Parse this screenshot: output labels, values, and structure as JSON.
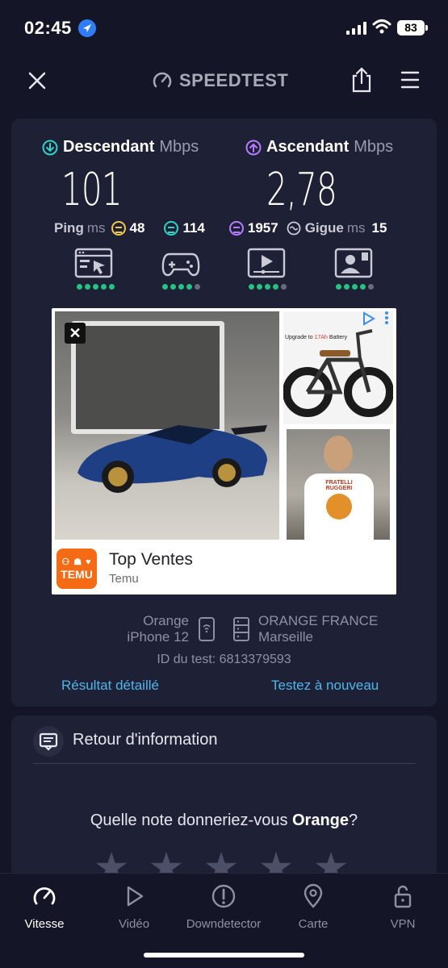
{
  "status": {
    "time": "02:45",
    "battery": "83"
  },
  "header": {
    "brand": "SPEEDTEST"
  },
  "results": {
    "download": {
      "label": "Descendant",
      "unit": "Mbps",
      "value": "101"
    },
    "upload": {
      "label": "Ascendant",
      "unit": "Mbps",
      "value": "2,78"
    },
    "ping": {
      "label": "Ping",
      "unit": "ms",
      "idle": "48",
      "download": "114",
      "upload": "1957"
    },
    "jitter": {
      "label": "Gigue",
      "unit": "ms",
      "value": "15"
    },
    "use_cases": [
      {
        "icon": "web-browsing-icon",
        "rating": 5
      },
      {
        "icon": "gaming-icon",
        "rating": 4
      },
      {
        "icon": "video-streaming-icon",
        "rating": 4
      },
      {
        "icon": "video-call-icon",
        "rating": 4
      }
    ]
  },
  "ad": {
    "title": "Top Ventes",
    "advertiser": "Temu",
    "logo_text": "TEMU",
    "bike_caption_prefix": "Upgrade to ",
    "bike_caption_highlight": "17Ah",
    "bike_caption_suffix": " Battery",
    "shirt_text": "FRATELLI\nRUGGERI"
  },
  "connection": {
    "provider": "Orange",
    "device": "iPhone 12",
    "server_name": "ORANGE FRANCE",
    "server_city": "Marseille",
    "test_id": "ID du test: 6813379593"
  },
  "actions": {
    "details": "Résultat détaillé",
    "retest": "Testez à nouveau"
  },
  "feedback": {
    "title": "Retour d'information",
    "question_prefix": "Quelle note donneriez-vous ",
    "question_brand": "Orange",
    "question_suffix": "?"
  },
  "tabs": [
    {
      "label": "Vitesse",
      "active": true
    },
    {
      "label": "Vidéo",
      "active": false
    },
    {
      "label": "Downdetector",
      "active": false
    },
    {
      "label": "Carte",
      "active": false
    },
    {
      "label": "VPN",
      "active": false
    }
  ],
  "colors": {
    "download": "#2fd3c7",
    "upload": "#b47cff",
    "link": "#4fb6ec",
    "good": "#26c281"
  }
}
